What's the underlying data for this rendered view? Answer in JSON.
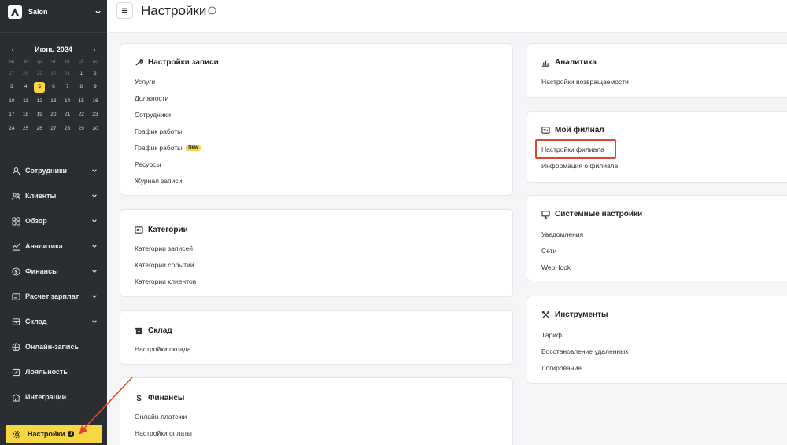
{
  "sidebar": {
    "brand": "Salon",
    "calendar": {
      "month": "Июнь 2024",
      "dow": [
        "пн",
        "вт",
        "ср",
        "чт",
        "пт",
        "сб",
        "вс"
      ],
      "days": [
        "27",
        "28",
        "29",
        "30",
        "31",
        "1",
        "2",
        "3",
        "4",
        "5",
        "6",
        "7",
        "8",
        "9",
        "10",
        "11",
        "12",
        "13",
        "14",
        "15",
        "16",
        "17",
        "18",
        "19",
        "20",
        "21",
        "22",
        "23",
        "24",
        "25",
        "26",
        "27",
        "28",
        "29",
        "30"
      ],
      "muted_count": 5,
      "today": "5"
    },
    "items": [
      {
        "label": "Сотрудники"
      },
      {
        "label": "Клиенты"
      },
      {
        "label": "Обзор"
      },
      {
        "label": "Аналитика"
      },
      {
        "label": "Финансы"
      },
      {
        "label": "Расчет зарплат"
      },
      {
        "label": "Склад"
      },
      {
        "label": "Онлайн-запись"
      },
      {
        "label": "Лояльность"
      },
      {
        "label": "Интеграции"
      }
    ],
    "active": {
      "label": "Настройки",
      "badge": "1"
    }
  },
  "header": {
    "title": "Настройки"
  },
  "cards": {
    "booking": {
      "title": "Настройки записи",
      "links": [
        "Услуги",
        "Должности",
        "Сотрудники",
        "График работы",
        "График работы",
        "Ресурсы",
        "Журнал записи"
      ],
      "new_label": "New"
    },
    "categories": {
      "title": "Категории",
      "links": [
        "Категории записей",
        "Категории событий",
        "Категории клиентов"
      ]
    },
    "warehouse": {
      "title": "Склад",
      "links": [
        "Настройки склада"
      ]
    },
    "finance": {
      "title": "Финансы",
      "links": [
        "Онлайн-платежи",
        "Настройки оплаты"
      ]
    },
    "analytics": {
      "title": "Аналитика",
      "links": [
        "Настройки возвращаемости"
      ]
    },
    "branch": {
      "title": "Мой филиал",
      "links": [
        "Настройки филиала",
        "Информация о филиале"
      ]
    },
    "system": {
      "title": "Системные настройки",
      "links": [
        "Уведомления",
        "Сети",
        "WebHook"
      ]
    },
    "tools": {
      "title": "Инструменты",
      "links": [
        "Тариф",
        "Восстановление удаленных",
        "Логирование"
      ]
    }
  },
  "colors": {
    "accent": "#f6d743",
    "sidebar": "#2a2d31",
    "highlight": "#e0452e"
  }
}
